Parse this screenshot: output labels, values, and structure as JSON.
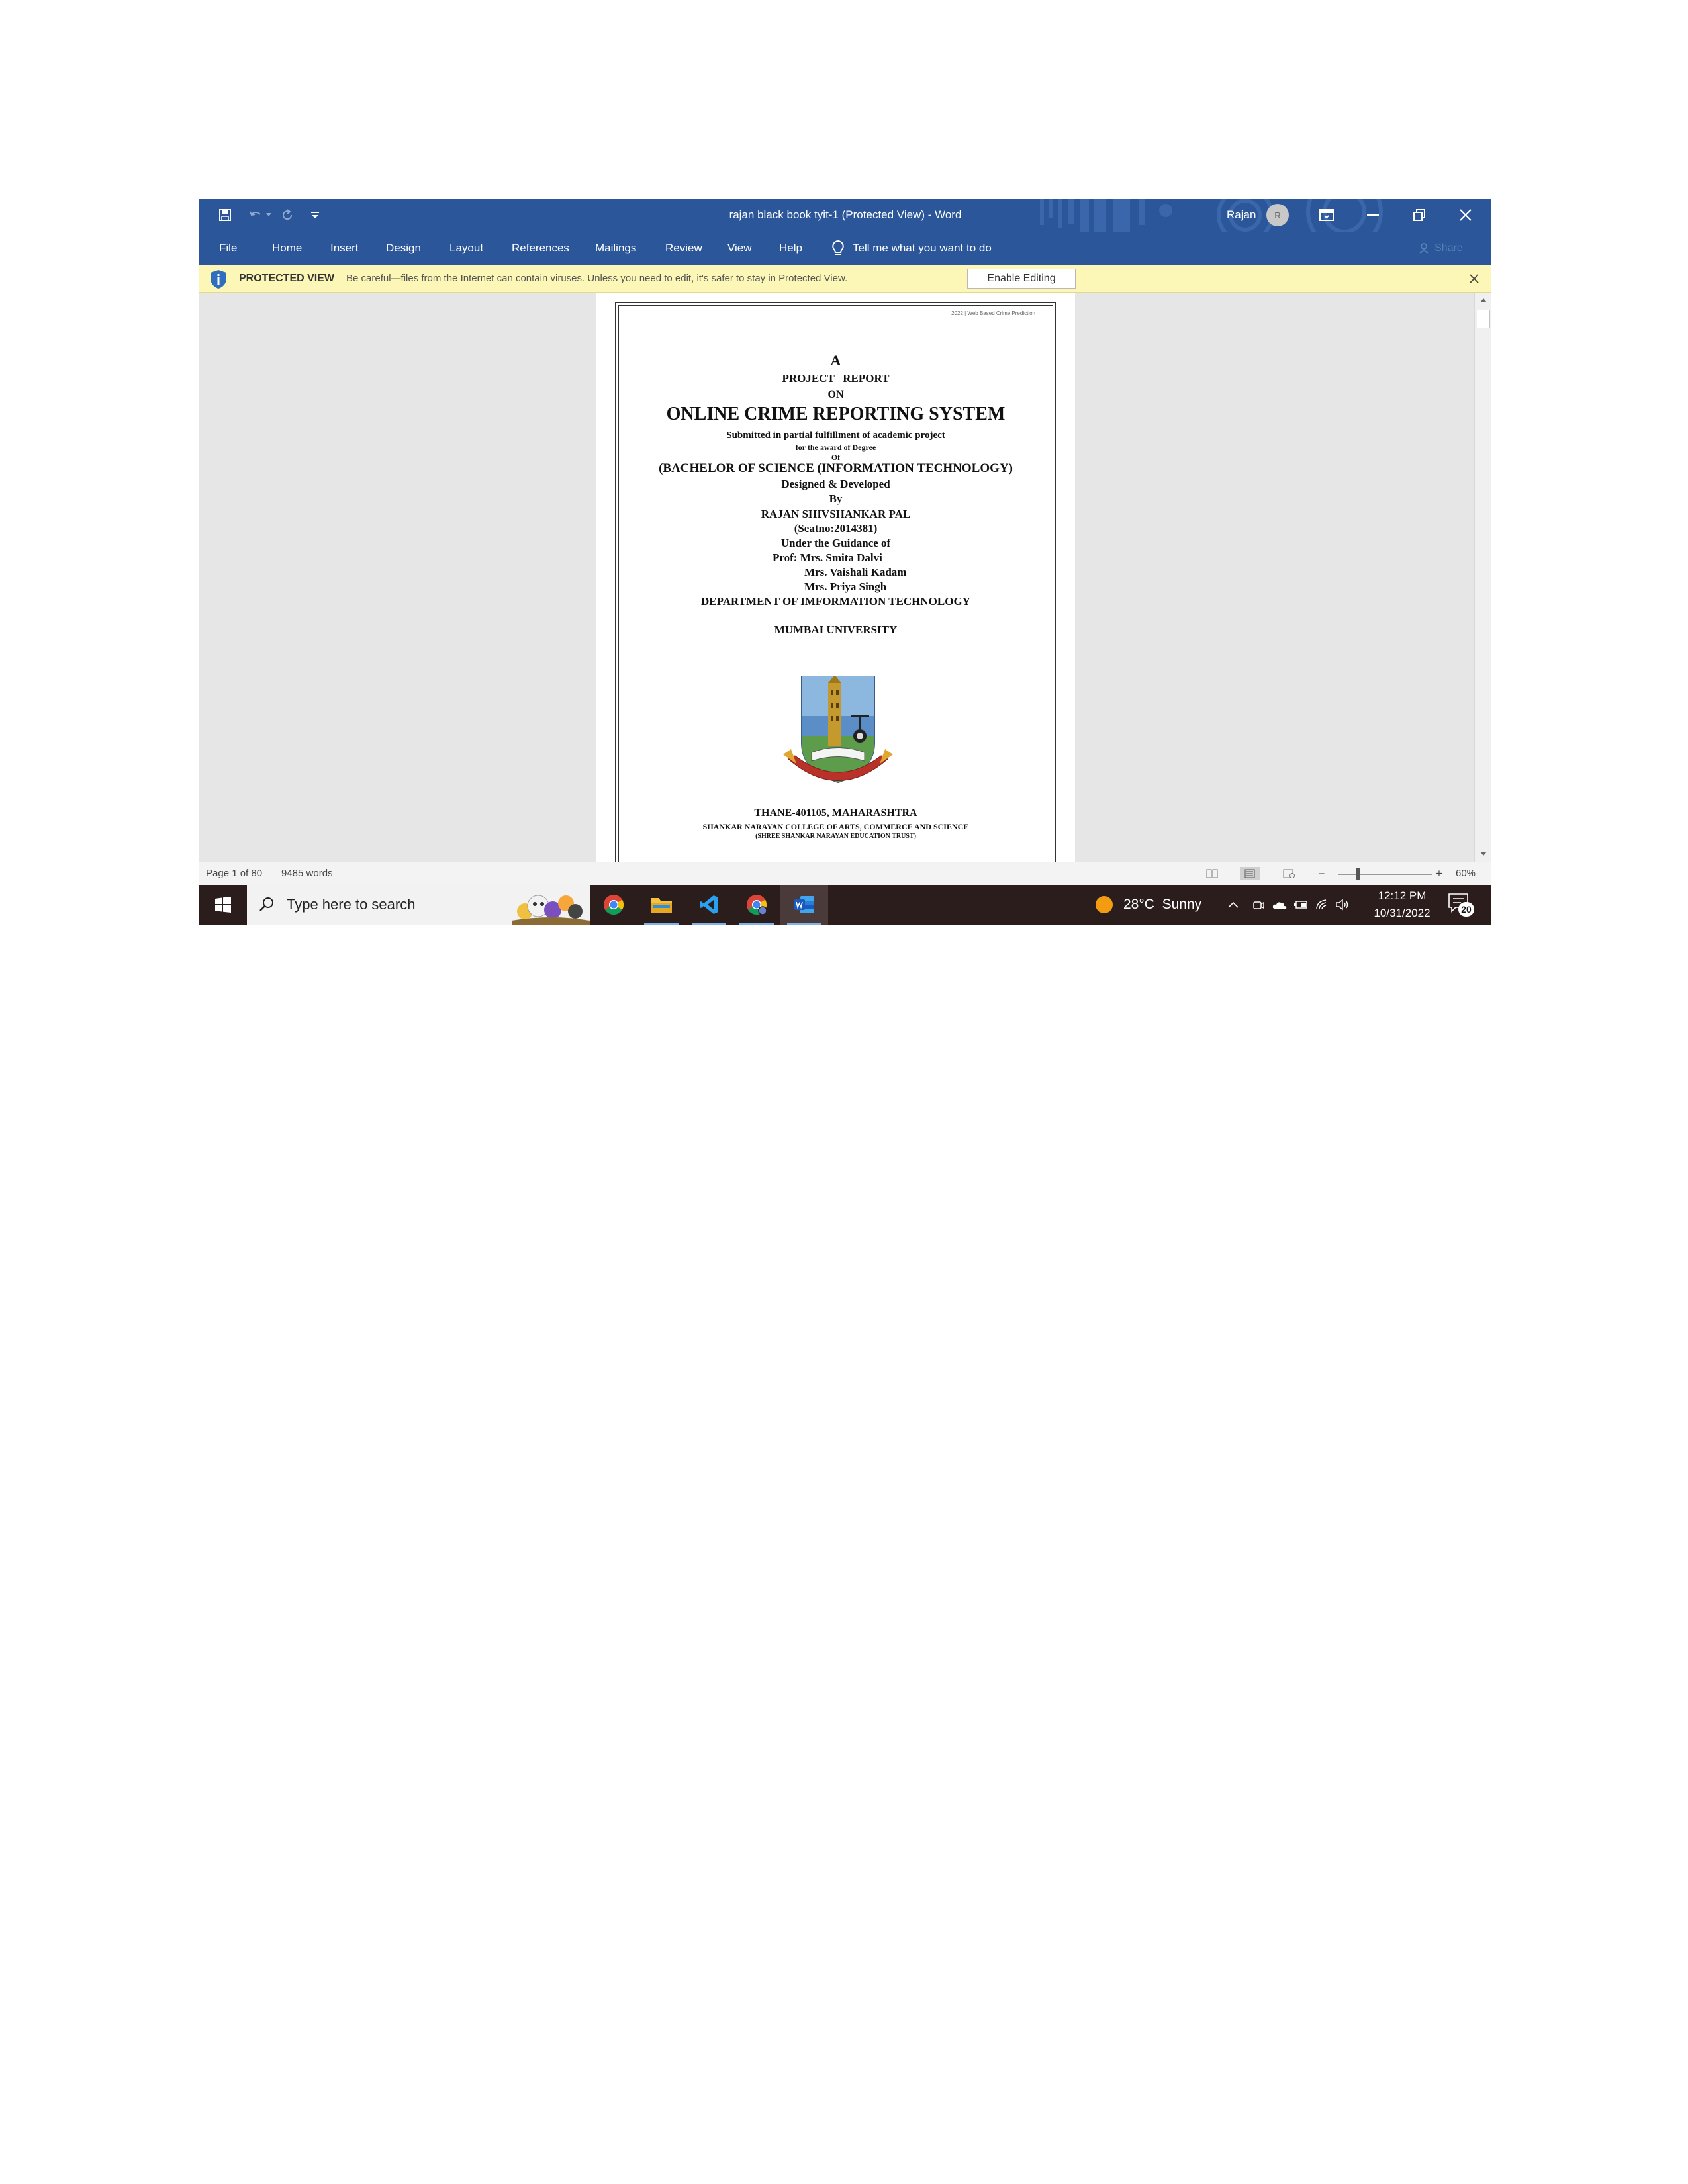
{
  "window": {
    "title": "rajan black book tyit-1 (Protected View)  -  Word",
    "user_name": "Rajan",
    "avatar_initial": "R"
  },
  "ribbon": {
    "tabs": [
      "File",
      "Home",
      "Insert",
      "Design",
      "Layout",
      "References",
      "Mailings",
      "Review",
      "View",
      "Help"
    ],
    "tell_me": "Tell me what you want to do",
    "share": "Share"
  },
  "protected_view": {
    "label": "PROTECTED VIEW",
    "message": "Be careful—files from the Internet can contain viruses. Unless you need to edit, it's safer to stay in Protected View.",
    "button": "Enable Editing"
  },
  "document": {
    "header_note": "2022 | Web Based Crime Prediction",
    "lines": {
      "a": "A",
      "project_report": "PROJECT   REPORT",
      "on": "ON",
      "title": "ONLINE CRIME REPORTING SYSTEM",
      "submitted": "Submitted in partial fulfillment of academic project",
      "award": "for the award of Degree",
      "of": "Of",
      "degree": "(BACHELOR OF SCIENCE (INFORMATION TECHNOLOGY)",
      "designed": "Designed & Developed",
      "by": "By",
      "author": "RAJAN SHIVSHANKAR PAL",
      "seat": "(Seatno:2014381)",
      "guidance": "Under the Guidance of",
      "prof1": "Prof: Mrs. Smita Dalvi",
      "prof2": "Mrs. Vaishali Kadam",
      "prof3": "Mrs. Priya Singh",
      "department": "DEPARTMENT OF IMFORMATION TECHNOLOGY",
      "university": "MUMBAI UNIVERSITY",
      "location": "THANE-401105, MAHARASHTRA",
      "college": "SHANKAR NARAYAN COLLEGE OF ARTS, COMMERCE AND SCIENCE",
      "trust": "(SHREE SHANKAR NARAYAN EDUCATION TRUST)"
    }
  },
  "status": {
    "page": "Page 1 of 80",
    "words": "9485 words",
    "zoom": "60%",
    "zoom_minus": "−",
    "zoom_plus": "+"
  },
  "taskbar": {
    "search_placeholder": "Type here to search",
    "weather": "28°C  Sunny",
    "time": "12:12 PM",
    "date": "10/31/2022",
    "notifications": "20"
  },
  "colors": {
    "word_blue": "#2b579a",
    "protected_bar": "#fcf7b6",
    "taskbar": "#2a1d1c"
  }
}
